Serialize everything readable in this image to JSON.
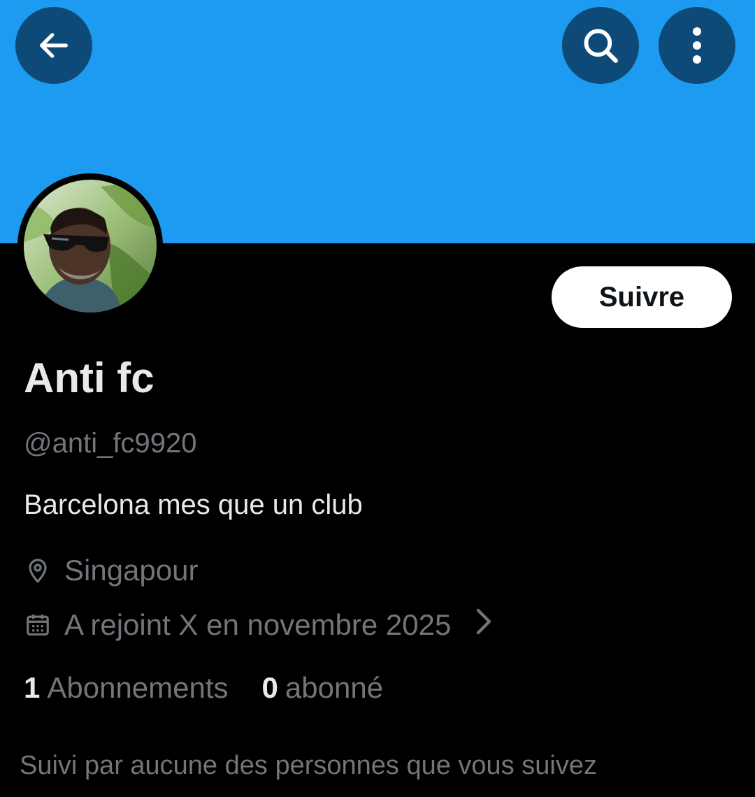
{
  "header": {
    "back_icon": "arrow-left-icon",
    "search_icon": "search-icon",
    "more_icon": "more-vertical-icon",
    "banner_color": "#1d9bf0",
    "button_color": "#0e4a77"
  },
  "profile": {
    "display_name": "Anti fc",
    "handle": "@anti_fc9920",
    "bio": "Barcelona mes que un club",
    "location": "Singapour",
    "joined": "A rejoint X en novembre 2025",
    "follow_label": "Suivre"
  },
  "stats": {
    "following_count": "1",
    "following_label": "Abonnements",
    "followers_count": "0",
    "followers_label": "abonné"
  },
  "followed_by": "Suivi par aucune des personnes que vous suivez"
}
